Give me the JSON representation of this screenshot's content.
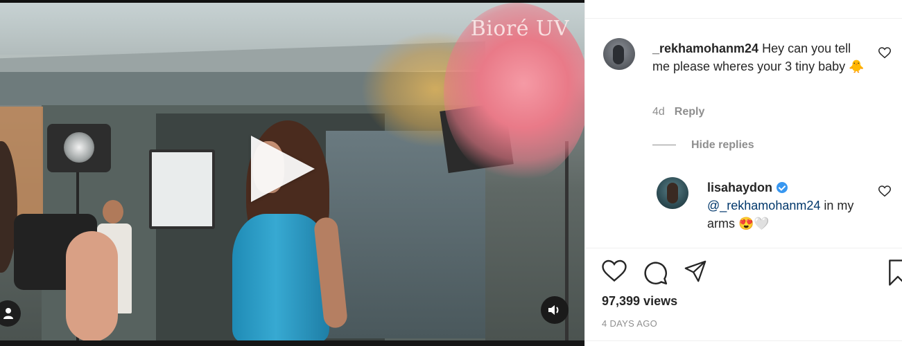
{
  "video": {
    "brand_watermark": "Bioré UV",
    "play_icon": "play-icon",
    "tag_icon": "user-tag-icon",
    "mute_icon": "speaker-icon"
  },
  "comments": [
    {
      "username": "_rekhamohanm24",
      "text": " Hey can you tell me please wheres your 3 tiny baby 🐥",
      "age": "4d",
      "reply_label": "Reply",
      "hide_replies_label": "Hide replies"
    }
  ],
  "reply": {
    "username": "lisahaydon",
    "verified": true,
    "mention": "@_rekhamohanm24",
    "text": " in my arms 😍🤍"
  },
  "post": {
    "views": "97,399 views",
    "date": "4 DAYS AGO"
  },
  "colors": {
    "text": "#262626",
    "muted": "#8e8e8e",
    "mention": "#00376b",
    "verified": "#3897f0"
  }
}
